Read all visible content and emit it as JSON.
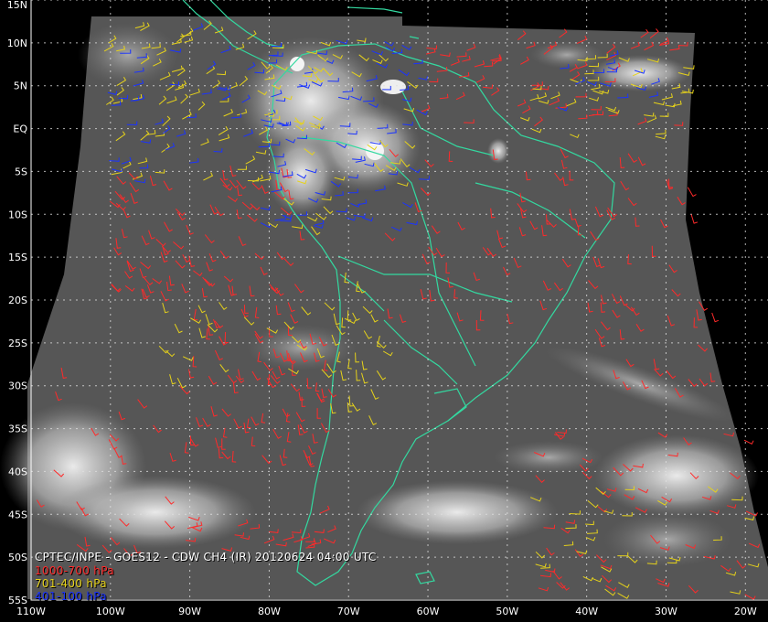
{
  "map": {
    "lon_range": [
      -110,
      -16
    ],
    "lat_range": [
      -55,
      15
    ],
    "lat_labels": [
      "15N",
      "10N",
      "5N",
      "EQ",
      "5S",
      "10S",
      "15S",
      "20S",
      "25S",
      "30S",
      "35S",
      "40S",
      "45S",
      "50S",
      "55S"
    ],
    "lat_values": [
      15,
      10,
      5,
      0,
      -5,
      -10,
      -15,
      -20,
      -25,
      -30,
      -35,
      -40,
      -45,
      -50,
      -55
    ],
    "lon_labels": [
      "110W",
      "100W",
      "90W",
      "80W",
      "70W",
      "60W",
      "50W",
      "40W",
      "30W",
      "20W"
    ],
    "lon_values": [
      -110,
      -100,
      -90,
      -80,
      -70,
      -60,
      -50,
      -40,
      -30,
      -20
    ],
    "colors": {
      "background": "#000000",
      "satellite_gray": "#555555",
      "coastline": "#33d9a0",
      "grid": "#e0e0e0",
      "wind_low": "#ff2a2a",
      "wind_mid": "#e6d21a",
      "wind_high": "#1a33ff"
    }
  },
  "caption": {
    "title": "CPTEC/INPE - GOES12 - CDW CH4 (IR) 20120624 04:00 UTC",
    "legend_low": "1000-700 hPa",
    "legend_mid": "701-400 hPa",
    "legend_high": "401-100 hPa"
  }
}
